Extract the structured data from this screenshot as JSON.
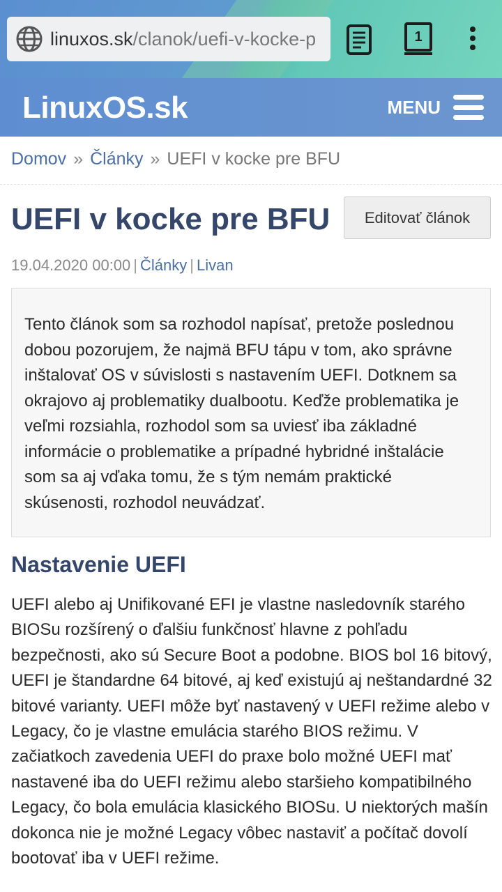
{
  "browser": {
    "url_domain": "linuxos.sk",
    "url_path": "/clanok/uefi-v-kocke-p",
    "tab_count": "1"
  },
  "site": {
    "logo": "LinuxOS.sk",
    "menu_label": "MENU"
  },
  "breadcrumb": {
    "items": [
      "Domov",
      "Články",
      "UEFI v kocke pre BFU"
    ],
    "separator": "»"
  },
  "article": {
    "title": "UEFI v kocke pre BFU",
    "edit_button": "Editovať článok",
    "date": "19.04.2020 00:00",
    "category": "Články",
    "author": "Livan",
    "intro": "Tento článok som sa rozhodol napísať, pretože poslednou dobou pozorujem, že najmä BFU tápu v tom, ako správne inštalovať OS v súvislosti s nastavením UEFI. Dotknem sa okrajovo aj problematiky dualbootu. Keďže problematika je veľmi rozsiahla, rozhodol som sa uviesť iba základné informácie o problematike a prípadné hybridné inštalácie som sa aj vďaka tomu, že s tým nemám praktické skúsenosti, rozhodol neuvádzať.",
    "section_heading": "Nastavenie UEFI",
    "section_body": "UEFI alebo aj Unifikované EFI je vlastne nasledovník starého BIOSu rozšírený o ďalšiu funkčnosť hlavne z pohľadu bezpečnosti, ako sú Secure Boot a podobne. BIOS bol 16 bitový, UEFI je štandardne 64 bitové, aj keď existujú aj neštandardné 32 bitové varianty. UEFI môže byť nastavený v UEFI režime alebo v Legacy, čo je vlastne emulácia starého BIOS režimu. V začiatkoch zavedenia UEFI do praxe bolo možné UEFI mať nastavené iba do UEFI režimu alebo staršieho kompatibilného Legacy, čo bola emulácia klasického BIOSu. U niektorých mašín dokonca nie je možné Legacy vôbec nastaviť a počítač dovolí bootovať iba v UEFI režime."
  },
  "colors": {
    "header_blue": "#6c96cf",
    "title_color": "#34466a",
    "link_color": "#4a6fa5"
  },
  "icons": [
    "globe-icon",
    "reader-mode-icon",
    "tabs-counter-icon",
    "more-vert-icon",
    "hamburger-menu-icon"
  ]
}
